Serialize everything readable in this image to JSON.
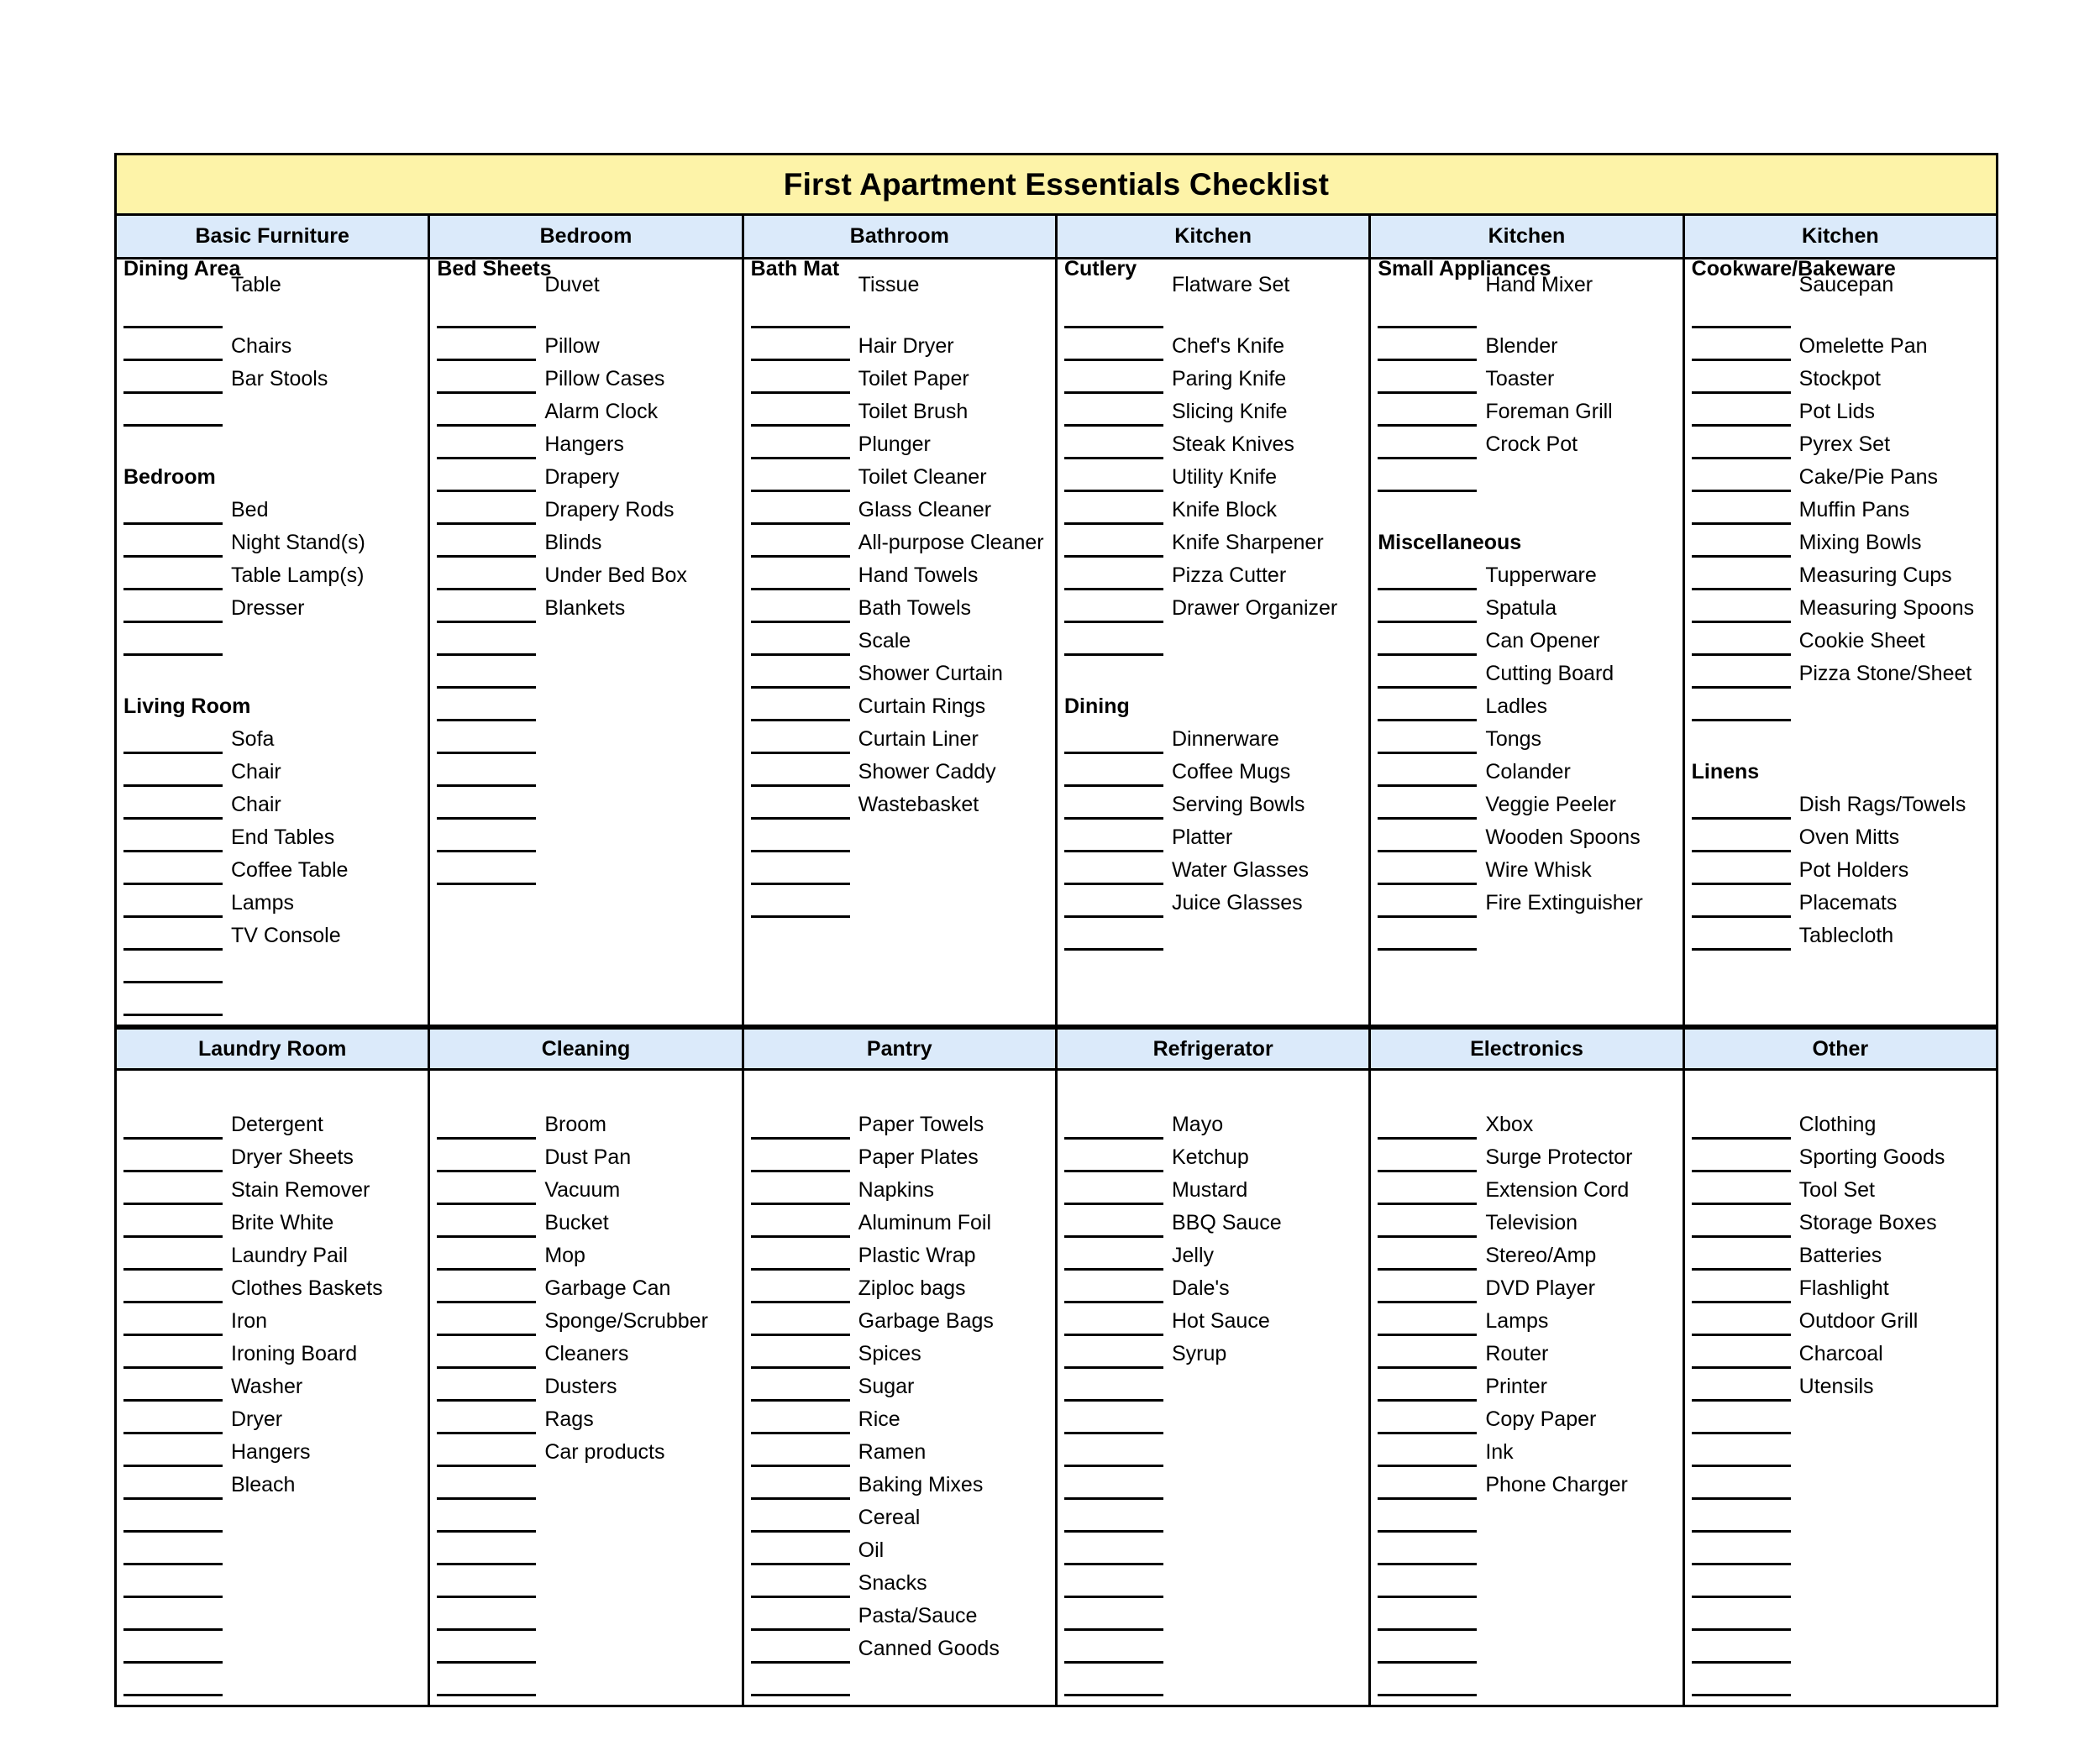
{
  "document": {
    "title": "First Apartment Essentials Checklist",
    "accent_banner_color": "#fdf3a8",
    "header_cell_color": "#dbeafa",
    "border_color": "#000000"
  },
  "top_headers": [
    "Basic Furniture",
    "Bedroom",
    "Bathroom",
    "Kitchen",
    "Kitchen",
    "Kitchen"
  ],
  "bottom_headers": [
    "Laundry Room",
    "Cleaning",
    "Pantry",
    "Refrigerator",
    "Electronics",
    "Other"
  ],
  "top_columns": [
    {
      "header": "Basic Furniture",
      "blocks": [
        {
          "subhead": "Dining Area",
          "items": [
            "Table",
            "Chairs",
            "Bar Stools"
          ],
          "trailing_blank_rules": 1,
          "gap_after": 1
        },
        {
          "subhead": "Bedroom",
          "items": [
            "Bed",
            "Night Stand(s)",
            "Table Lamp(s)",
            "Dresser"
          ],
          "trailing_blank_rules": 1,
          "gap_after": 1
        },
        {
          "subhead": "Living Room",
          "items": [
            "Sofa",
            "Chair",
            "Chair",
            "End Tables",
            "Coffee Table",
            "Lamps",
            "TV Console"
          ],
          "trailing_blank_rules": 2,
          "gap_after": 0
        }
      ]
    },
    {
      "header": "Bedroom",
      "blocks": [
        {
          "subhead": "Bed Sheets",
          "items": [
            "Duvet",
            "Pillow",
            "Pillow Cases",
            "Alarm Clock",
            "Hangers",
            "Drapery",
            "Drapery Rods",
            "Blinds",
            "Under Bed Box",
            "Blankets"
          ],
          "trailing_blank_rules": 8,
          "gap_after": 0
        }
      ]
    },
    {
      "header": "Bathroom",
      "blocks": [
        {
          "subhead": "Bath Mat",
          "items": [
            "Tissue",
            "Hair Dryer",
            "Toilet Paper",
            "Toilet Brush",
            "Plunger",
            "Toilet Cleaner",
            "Glass Cleaner",
            "All-purpose Cleaner",
            "Hand Towels",
            "Bath Towels",
            "Scale",
            "Shower Curtain",
            "Curtain Rings",
            "Curtain Liner",
            "Shower Caddy",
            "Wastebasket"
          ],
          "trailing_blank_rules": 3,
          "gap_after": 0
        }
      ]
    },
    {
      "header": "Kitchen",
      "blocks": [
        {
          "subhead": "Cutlery",
          "items": [
            "Flatware Set",
            "Chef's Knife",
            "Paring Knife",
            "Slicing Knife",
            "Steak Knives",
            "Utility Knife",
            "Knife Block",
            "Knife Sharpener",
            "Pizza Cutter",
            "Drawer Organizer"
          ],
          "trailing_blank_rules": 1,
          "gap_after": 1
        },
        {
          "subhead": "Dining",
          "items": [
            "Dinnerware",
            "Coffee Mugs",
            "Serving Bowls",
            "Platter",
            "Water Glasses",
            "Juice Glasses"
          ],
          "trailing_blank_rules": 1,
          "gap_after": 0
        }
      ]
    },
    {
      "header": "Kitchen",
      "blocks": [
        {
          "subhead": "Small Appliances",
          "items": [
            "Hand Mixer",
            "Blender",
            "Toaster",
            "Foreman Grill",
            "Crock Pot"
          ],
          "trailing_blank_rules": 1,
          "gap_after": 1
        },
        {
          "subhead": "Miscellaneous",
          "items": [
            "Tupperware",
            "Spatula",
            "Can Opener",
            "Cutting Board",
            "Ladles",
            "Tongs",
            "Colander",
            "Veggie Peeler",
            "Wooden Spoons",
            "Wire Whisk",
            "Fire Extinguisher"
          ],
          "trailing_blank_rules": 1,
          "gap_after": 0
        }
      ]
    },
    {
      "header": "Kitchen",
      "blocks": [
        {
          "subhead": "Cookware/Bakeware",
          "items": [
            "Saucepan",
            "Omelette Pan",
            "Stockpot",
            "Pot Lids",
            "Pyrex Set",
            "Cake/Pie Pans",
            "Muffin Pans",
            "Mixing Bowls",
            "Measuring Cups",
            "Measuring Spoons",
            "Cookie Sheet",
            "Pizza Stone/Sheet"
          ],
          "trailing_blank_rules": 1,
          "gap_after": 1
        },
        {
          "subhead": "Linens",
          "items": [
            "Dish Rags/Towels",
            "Oven Mitts",
            "Pot Holders",
            "Placemats",
            "Tablecloth"
          ],
          "trailing_blank_rules": 0,
          "gap_after": 0
        }
      ]
    }
  ],
  "bottom_columns": [
    {
      "header": "Laundry Room",
      "items": [
        "Detergent",
        "Dryer Sheets",
        "Stain Remover",
        "Brite White",
        "Laundry Pail",
        "Clothes Baskets",
        "Iron",
        "Ironing Board",
        "Washer",
        "Dryer",
        "Hangers",
        "Bleach"
      ],
      "trailing_blank_rules": 6
    },
    {
      "header": "Cleaning",
      "items": [
        "Broom",
        "Dust Pan",
        "Vacuum",
        "Bucket",
        "Mop",
        "Garbage Can",
        "Sponge/Scrubber",
        "Cleaners",
        "Dusters",
        "Rags",
        "Car products"
      ],
      "trailing_blank_rules": 7
    },
    {
      "header": "Pantry",
      "items": [
        "Paper Towels",
        "Paper Plates",
        "Napkins",
        "Aluminum Foil",
        "Plastic Wrap",
        "Ziploc bags",
        "Garbage Bags",
        "Spices",
        "Sugar",
        "Rice",
        "Ramen",
        "Baking Mixes",
        "Cereal",
        "Oil",
        "Snacks",
        "Pasta/Sauce",
        "Canned Goods"
      ],
      "trailing_blank_rules": 1
    },
    {
      "header": "Refrigerator",
      "items": [
        "Mayo",
        "Ketchup",
        "Mustard",
        "BBQ Sauce",
        "Jelly",
        "Dale's",
        "Hot Sauce",
        "Syrup"
      ],
      "trailing_blank_rules": 10
    },
    {
      "header": "Electronics",
      "items": [
        "Xbox",
        "Surge Protector",
        "Extension Cord",
        "Television",
        "Stereo/Amp",
        "DVD Player",
        "Lamps",
        "Router",
        "Printer",
        "Copy Paper",
        "Ink",
        "Phone Charger"
      ],
      "trailing_blank_rules": 6
    },
    {
      "header": "Other",
      "items": [
        "Clothing",
        "Sporting Goods",
        "Tool Set",
        "Storage Boxes",
        "Batteries",
        "Flashlight",
        "Outdoor Grill",
        "Charcoal",
        "Utensils"
      ],
      "trailing_blank_rules": 9
    }
  ]
}
